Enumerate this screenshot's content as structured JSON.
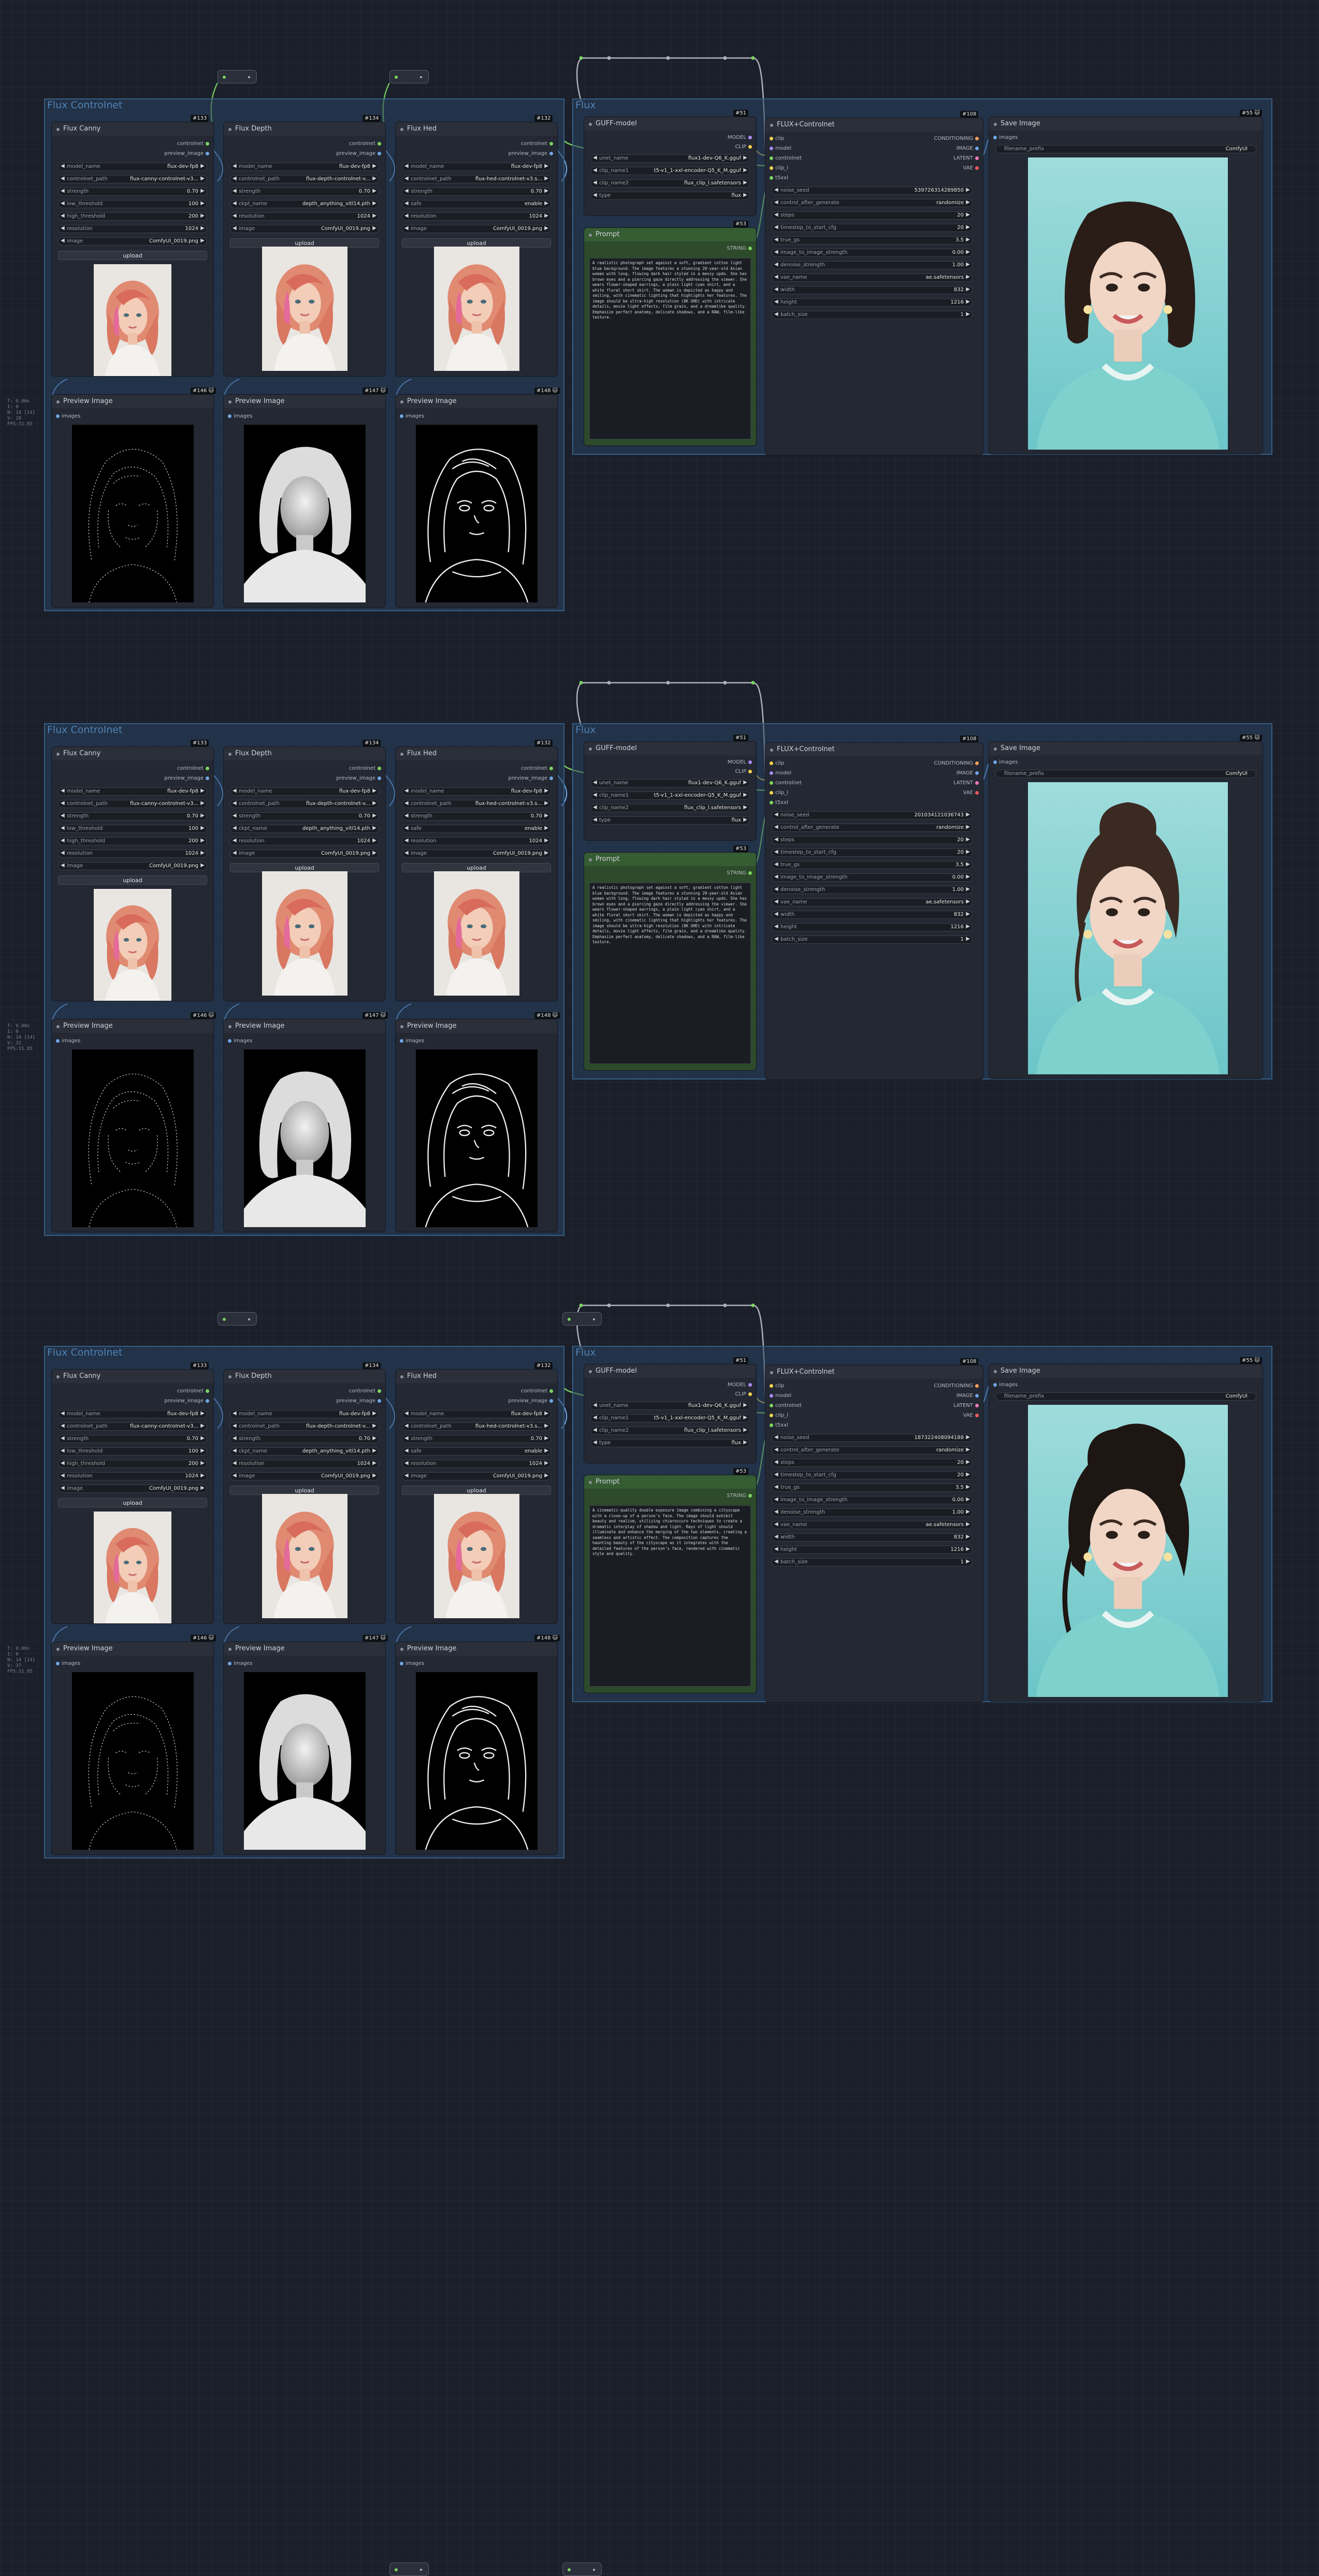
{
  "ui": {
    "group_controlnet": "Flux Controlnet",
    "group_flux": "Flux",
    "canny": {
      "title": "Flux Canny",
      "badge": "#133",
      "out1": "controlnet",
      "out2": "preview_image",
      "w": [
        [
          "model_name",
          "flux-dev-fp8"
        ],
        [
          "controlnet_path",
          "flux-canny-controlnet-v3..."
        ],
        [
          "strength",
          "0.70"
        ],
        [
          "low_threshold",
          "100"
        ],
        [
          "high_threshold",
          "200"
        ],
        [
          "resolution",
          "1024"
        ],
        [
          "image",
          "ComfyUI_0019.png"
        ]
      ],
      "upload": "upload"
    },
    "depth": {
      "title": "Flux Depth",
      "badge": "#134",
      "out1": "controlnet",
      "out2": "preview_image",
      "w": [
        [
          "model_name",
          "flux-dev-fp8"
        ],
        [
          "controlnet_path",
          "flux-depth-controlnet-v..."
        ],
        [
          "strength",
          "0.70"
        ],
        [
          "ckpt_name",
          "depth_anything_vitl14.pth"
        ],
        [
          "resolution",
          "1024"
        ],
        [
          "image",
          "ComfyUI_0019.png"
        ]
      ],
      "upload": "upload"
    },
    "hed": {
      "title": "Flux Hed",
      "badge": "#132",
      "out1": "controlnet",
      "out2": "preview_image",
      "w": [
        [
          "model_name",
          "flux-dev-fp8"
        ],
        [
          "controlnet_path",
          "flux-hed-controlnet-v3.s..."
        ],
        [
          "strength",
          "0.70"
        ],
        [
          "safe",
          "enable"
        ],
        [
          "resolution",
          "1024"
        ],
        [
          "image",
          "ComfyUI_0019.png"
        ]
      ],
      "upload": "upload"
    },
    "previews": [
      {
        "title": "Preview Image",
        "badge": "#146 🐱",
        "input": "images"
      },
      {
        "title": "Preview Image",
        "badge": "#147 🐱",
        "input": "images"
      },
      {
        "title": "Preview Image",
        "badge": "#148 🐱",
        "input": "images"
      }
    ],
    "guff": {
      "title": "GUFF-model",
      "badge": "#51",
      "outs": [
        "MODEL",
        "CLIP"
      ],
      "w": [
        [
          "unet_name",
          "flux1-dev-Q6_K.gguf"
        ],
        [
          "clip_name1",
          "t5-v1_1-xxl-encoder-Q5_K_M.gguf"
        ],
        [
          "clip_name2",
          "flux_clip_l.safetensors"
        ],
        [
          "type",
          "flux"
        ]
      ]
    },
    "prompt": {
      "title": "Prompt",
      "badge": "#53",
      "out": "STRING"
    },
    "flux": {
      "title": "FLUX+Controlnet",
      "badge": "#108",
      "ins": [
        "clip",
        "model",
        "controlnet",
        "clip_l",
        "t5xxl"
      ],
      "outs": [
        "CONDITIONING",
        "IMAGE",
        "LATENT",
        "VAE"
      ]
    },
    "save": {
      "title": "Save Image",
      "badge": "#55 🐱",
      "input": "images",
      "prefix_label": "filename_prefix",
      "prefix_value": "ComfyUI"
    }
  },
  "sections": [
    {
      "stats": "T: 0.00s\nI: 0\nN: 14 [14]\nV: 28\nFPS:31.85",
      "seed": "539726314289850",
      "prompt_text": "A realistic photograph set against a soft, gradient cotton light blue background. The image features a stunning 20-year-old Asian woman with long, flowing dark hair styled in a messy updo. She has brown eyes and a piercing gaze directly addressing the viewer. She wears flower-shaped earrings, a plain light cyan shirt, and a white floral short skirt. The woman is depicted as happy and smiling, with cinematic lighting that highlights her features. The image should be ultra-high resolution (8K UHD) with intricate details, movie light effects, film grain, and a dreamlike quality. Emphasize perfect anatomy, delicate shadows, and a RAW, film-like texture."
    },
    {
      "stats": "T: 0.00s\nI: 0\nN: 14 [14]\nV: 32\nFPS:31.85",
      "seed": "201034121036743",
      "prompt_text": "A realistic photograph set against a soft, gradient cotton light blue background. The image features a stunning 20-year-old Asian woman with long, flowing dark hair styled in a messy updo. She has brown eyes and a piercing gaze directly addressing the viewer. She wears flower-shaped earrings, a plain light cyan shirt, and a white floral short skirt. The woman is depicted as happy and smiling, with cinematic lighting that highlights her features. The image should be ultra-high resolution (8K UHD) with intricate details, movie light effects, film grain, and a dreamlike quality. Emphasize perfect anatomy, delicate shadows, and a RAW, film-like texture."
    },
    {
      "stats": "T: 0.00s\nI: 0\nN: 14 [14]\nV: 37\nFPS:31.85",
      "seed": "187322408094188",
      "prompt_text": "A cinematic-quality double exposure image combining a cityscape with a close-up of a person's face. The image should exhibit beauty and realism, utilizing chiaroscuro techniques to create a dramatic interplay of shadow and light. Rays of light should illuminate and enhance the merging of the two elements, creating a seamless and artistic effect. The composition captures the haunting beauty of the cityscape as it integrates with the detailed features of the person's face, rendered with cinematic style and quality."
    }
  ],
  "flux_widgets_common": [
    [
      "noise_seed",
      null
    ],
    [
      "control_after_generate",
      "randomize"
    ],
    [
      "steps",
      "20"
    ],
    [
      "timestep_to_start_cfg",
      "20"
    ],
    [
      "true_gs",
      "3.5"
    ],
    [
      "image_to_image_strength",
      "0.00"
    ],
    [
      "denoise_strength",
      "1.00"
    ],
    [
      "vae_name",
      "ae.safetensors"
    ],
    [
      "width",
      "832"
    ],
    [
      "height",
      "1216"
    ],
    [
      "batch_size",
      "1"
    ]
  ],
  "colors": {
    "accent_group": "#355d82",
    "prompt_green": "#2d4a2b",
    "link_green": "#7cd35e",
    "cyan_bg": "#8fd6d6"
  }
}
